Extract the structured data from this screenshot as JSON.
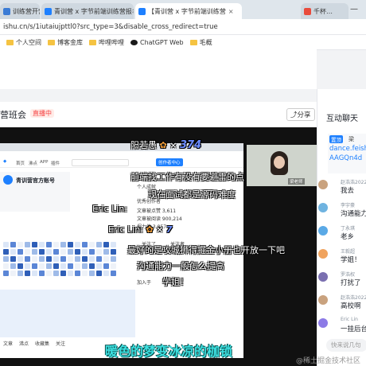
{
  "browser": {
    "tabs": [
      {
        "label": "训练营开营",
        "favicon_color": "#3a7bd5",
        "active": false
      },
      {
        "label": "青训营 x 字节前端训练营报名开",
        "favicon_color": "#1e80ff",
        "active": false
      },
      {
        "label": "【青训营 x 字节前端训练营",
        "favicon_color": "#1e80ff",
        "active": true
      },
      {
        "label": "千杯…",
        "favicon_color": "#e94b3c",
        "active": false
      }
    ],
    "address": "ishu.cn/s/1iutaiujpttl0?src_type=3&disable_cross_redirect=true",
    "bookmarks": [
      "个人空间",
      "博客金库",
      "哔哩哔哩",
      "ChatGPT Web",
      "毛概"
    ]
  },
  "room": {
    "title": "营班会",
    "live_badge": "直播中",
    "share_label": "分享"
  },
  "slide": {
    "header": "青训营官方账号",
    "menu": [
      "首页",
      "沸点",
      "APP",
      "插件"
    ],
    "stats": [
      "个人成就",
      "优秀创作者",
      "文章被点赞 3,611",
      "文章被阅读 900,214",
      "掘力值 3,857"
    ],
    "follow_btn": "关注了",
    "followers_label": "关注者",
    "following_count": "9,628",
    "join_label": "加入于",
    "nav_items": [
      "文章",
      "沸点",
      "收藏集",
      "关注"
    ],
    "green_btn": "创作者中心"
  },
  "camera": {
    "name": "梁老师"
  },
  "danmu": [
    {
      "text": "阳若愚",
      "sub": "374"
    },
    {
      "text": "前端找工作有没有要避雷的点"
    },
    {
      "text": "现在面试都是源码难度"
    },
    {
      "text": "Eric Lin:"
    },
    {
      "text": "Eric Lin:",
      "sub": "7"
    },
    {
      "text": "最好的是攻城狮得掘金小册也开放一下吧"
    },
    {
      "text": "沟通能力一般怎么提高"
    },
    {
      "text": "学姐！"
    }
  ],
  "caption": "暖色的梦变冰凉的枷锁",
  "chat": {
    "title": "互动聊天",
    "pinned_tag": "置顶",
    "pinned_text": "dance.feishu.",
    "pinned_text2": "AAGQn4d",
    "pinned_user": "梁",
    "messages": [
      {
        "user": "赵浩浩2022",
        "text": "我去",
        "avatar_color": "#c9a27e"
      },
      {
        "user": "李宇豪",
        "text": "沟通能力一",
        "avatar_color": "#6fb3e0"
      },
      {
        "user": "丁永琪",
        "text": "老乡",
        "avatar_color": "#5aa9e6"
      },
      {
        "user": "王毅超",
        "text": "学姐！",
        "avatar_color": "#f0a35e"
      },
      {
        "user": "罗浩权",
        "text": "打扰了",
        "avatar_color": "#7a6fb0"
      },
      {
        "user": "赵浩浩2022",
        "text": "高校啊",
        "avatar_color": "#c9a27e"
      },
      {
        "user": "Eric Lin",
        "text": "一挂后台",
        "avatar_color": "#8c7ae6"
      }
    ],
    "input_placeholder": "快来说几句",
    "watermark": "@稀土掘金技术社区"
  }
}
